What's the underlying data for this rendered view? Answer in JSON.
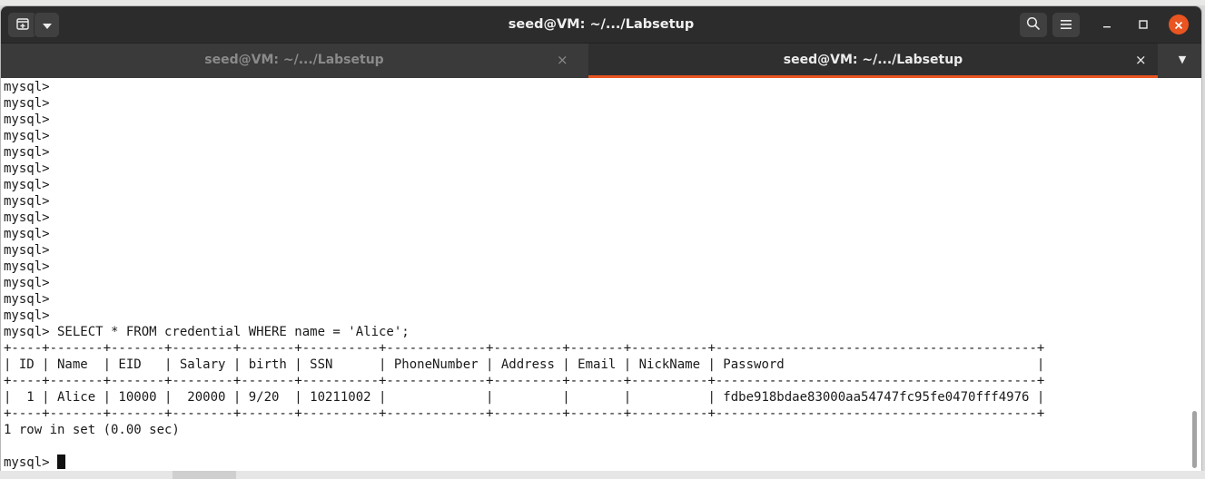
{
  "window": {
    "title": "seed@VM: ~/.../Labsetup",
    "controls": {
      "new_tab_icon": "new-tab-icon",
      "menu_dropdown_icon": "chevron-down-icon",
      "search_icon": "search-icon",
      "hamburger_icon": "hamburger-menu-icon",
      "minimize_icon": "minimize-icon",
      "maximize_icon": "maximize-icon",
      "close_icon": "close-icon"
    },
    "accent_color": "#e95420"
  },
  "tabs": [
    {
      "label": "seed@VM: ~/.../Labsetup",
      "close": "×",
      "active": false
    },
    {
      "label": "seed@VM: ~/.../Labsetup",
      "close": "×",
      "active": true
    }
  ],
  "tab_list_icon": "▼",
  "terminal": {
    "lines": [
      "mysql>",
      "mysql>",
      "mysql>",
      "mysql>",
      "mysql>",
      "mysql>",
      "mysql>",
      "mysql>",
      "mysql>",
      "mysql>",
      "mysql>",
      "mysql>",
      "mysql>",
      "mysql>",
      "mysql>",
      "mysql> SELECT * FROM credential WHERE name = 'Alice';",
      "+----+-------+-------+--------+-------+----------+-------------+---------+-------+----------+------------------------------------------+",
      "| ID | Name  | EID   | Salary | birth | SSN      | PhoneNumber | Address | Email | NickName | Password                                 |",
      "+----+-------+-------+--------+-------+----------+-------------+---------+-------+----------+------------------------------------------+",
      "|  1 | Alice | 10000 |  20000 | 9/20  | 10211002 |             |         |       |          | fdbe918bdae83000aa54747fc95fe0470fff4976 |",
      "+----+-------+-------+--------+-------+----------+-------------+---------+-------+----------+------------------------------------------+",
      "1 row in set (0.00 sec)",
      ""
    ],
    "prompt": "mysql> "
  }
}
